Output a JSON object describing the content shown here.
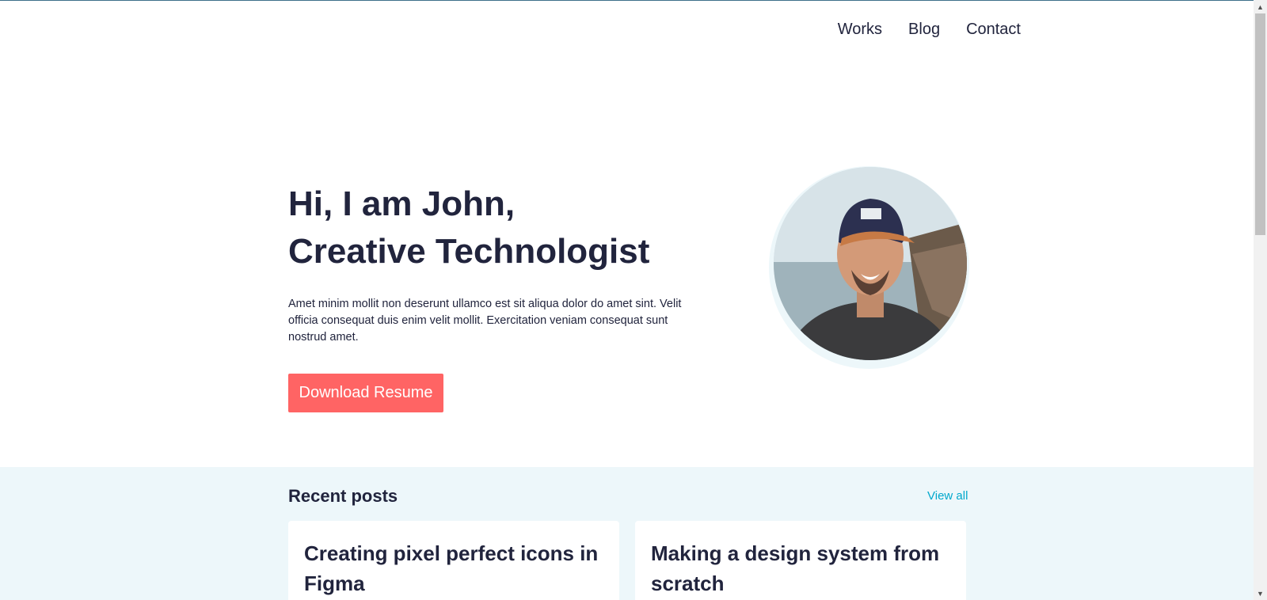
{
  "nav": {
    "items": [
      {
        "label": "Works"
      },
      {
        "label": "Blog"
      },
      {
        "label": "Contact"
      }
    ]
  },
  "hero": {
    "title_line1": "Hi, I am John,",
    "title_line2": "Creative Technologist",
    "description": "Amet minim mollit non deserunt ullamco est sit aliqua dolor do amet sint. Velit officia consequat duis enim velit mollit. Exercitation veniam consequat sunt nostrud amet.",
    "button_label": "Download Resume"
  },
  "recent_posts": {
    "title": "Recent posts",
    "view_all_label": "View all",
    "posts": [
      {
        "title": "Creating pixel perfect icons in Figma"
      },
      {
        "title": "Making a design system from scratch"
      }
    ]
  },
  "colors": {
    "accent": "#FF6464",
    "link": "#00A8CC",
    "text": "#21243D",
    "section_bg": "#EDF7FA"
  },
  "scrollbar": {
    "up_icon": "triangle-up-icon",
    "down_icon": "triangle-down-icon"
  }
}
